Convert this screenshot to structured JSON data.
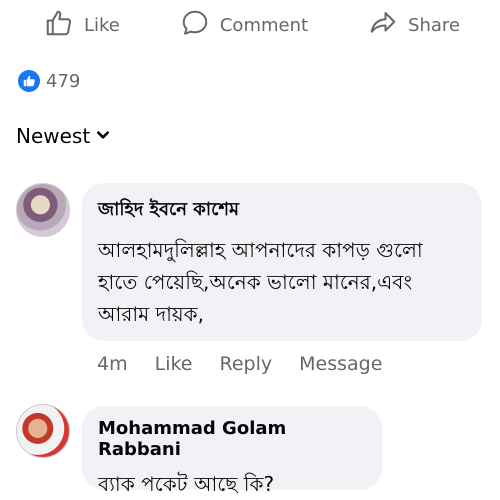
{
  "actions": {
    "like_label": "Like",
    "comment_label": "Comment",
    "share_label": "Share"
  },
  "reactions": {
    "count": "479",
    "icon": "thumbs-up-icon",
    "color": "#1877f2"
  },
  "sort": {
    "label": "Newest",
    "icon": "chevron-down-icon"
  },
  "comments": [
    {
      "author": "জাহিদ ইবনে কাশেম",
      "text": "আলহামদুলিল্লাহ আপনাদের কাপড় গুলো হাতে পেয়েছি,অনেক ভালো মানের,এবং আরাম দায়ক,",
      "time": "4m",
      "like_label": "Like",
      "reply_label": "Reply",
      "message_label": "Message"
    },
    {
      "author": "Mohammad Golam Rabbani",
      "text": "ব্যাক পকেট আছে কি?"
    }
  ]
}
